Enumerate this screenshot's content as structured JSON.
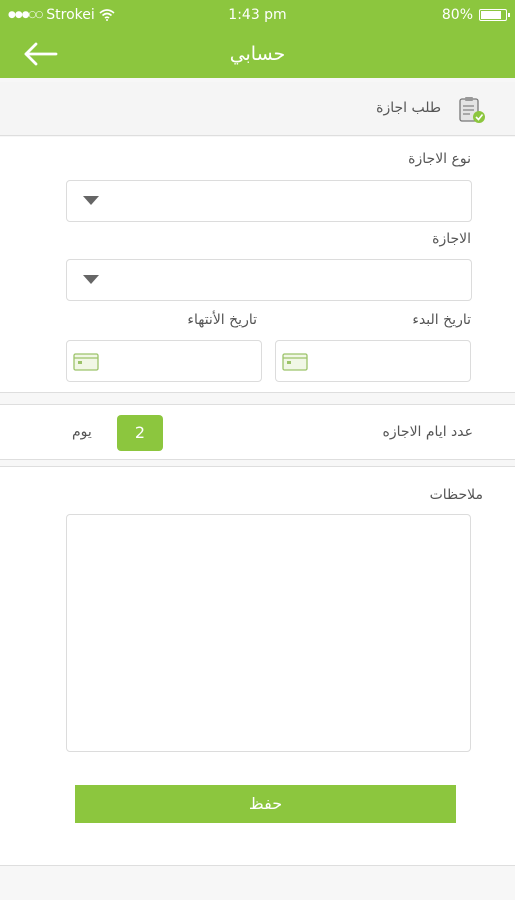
{
  "status_bar": {
    "signal": "●●●○○",
    "carrier": "Strokei",
    "time": "1:43 pm",
    "battery": "80%"
  },
  "nav": {
    "title": "حسابي",
    "back_icon": "arrow-left-icon"
  },
  "section": {
    "title": "طلب اجازة",
    "icon": "clipboard-check-icon"
  },
  "form": {
    "leave_type_label": "نوع الاجازة",
    "leave_label": "الاجازة",
    "start_date_label": "تاريخ البدء",
    "end_date_label": "تاريخ الأنتهاء"
  },
  "days": {
    "label": "عدد ايام الاجازه",
    "count": "2",
    "unit": "يوم"
  },
  "notes": {
    "label": "ملاحظات"
  },
  "save_button": "حفظ",
  "colors": {
    "accent": "#8cc63e",
    "border": "#dcdcdc",
    "text": "#555555"
  }
}
